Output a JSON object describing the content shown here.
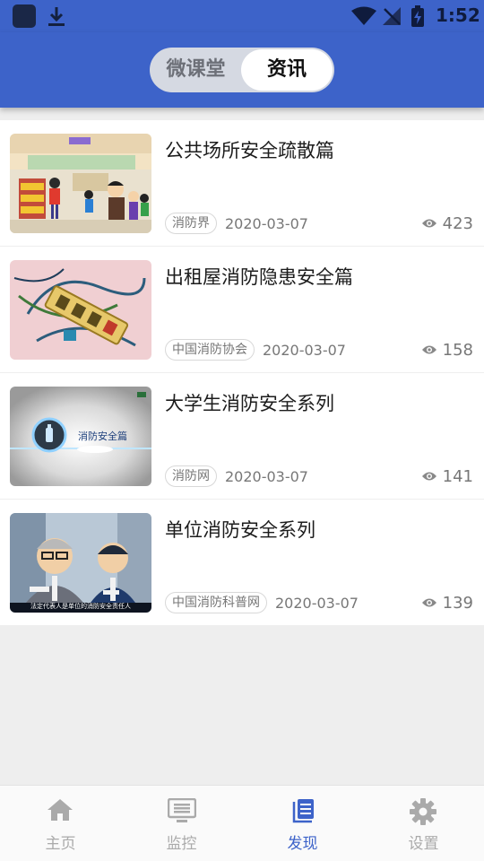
{
  "status_bar": {
    "time": "1:52"
  },
  "header": {
    "tabs": [
      {
        "label": "微课堂",
        "active": false
      },
      {
        "label": "资讯",
        "active": true
      }
    ]
  },
  "articles": [
    {
      "title": "公共场所安全疏散篇",
      "source": "消防界",
      "date": "2020-03-07",
      "views": "423",
      "thumbnail": "cartoon-supermarket"
    },
    {
      "title": "出租屋消防隐患安全篇",
      "source": "中国消防协会",
      "date": "2020-03-07",
      "views": "158",
      "thumbnail": "power-strip-wires"
    },
    {
      "title": "大学生消防安全系列",
      "source": "消防网",
      "date": "2020-03-07",
      "views": "141",
      "thumbnail": "extinguisher-title-card",
      "thumbnail_caption": "消防安全篇"
    },
    {
      "title": "单位消防安全系列",
      "source": "中国消防科普网",
      "date": "2020-03-07",
      "views": "139",
      "thumbnail": "cartoon-two-men",
      "thumbnail_caption": "法定代表人是单位的消防安全责任人"
    }
  ],
  "bottom_nav": [
    {
      "label": "主页",
      "icon": "home-icon",
      "active": false
    },
    {
      "label": "监控",
      "icon": "monitor-icon",
      "active": false
    },
    {
      "label": "发现",
      "icon": "book-icon",
      "active": true
    },
    {
      "label": "设置",
      "icon": "gear-icon",
      "active": false
    }
  ],
  "colors": {
    "primary": "#3d63c9",
    "inactive": "#aaaaaa",
    "background": "#eeeeee"
  }
}
